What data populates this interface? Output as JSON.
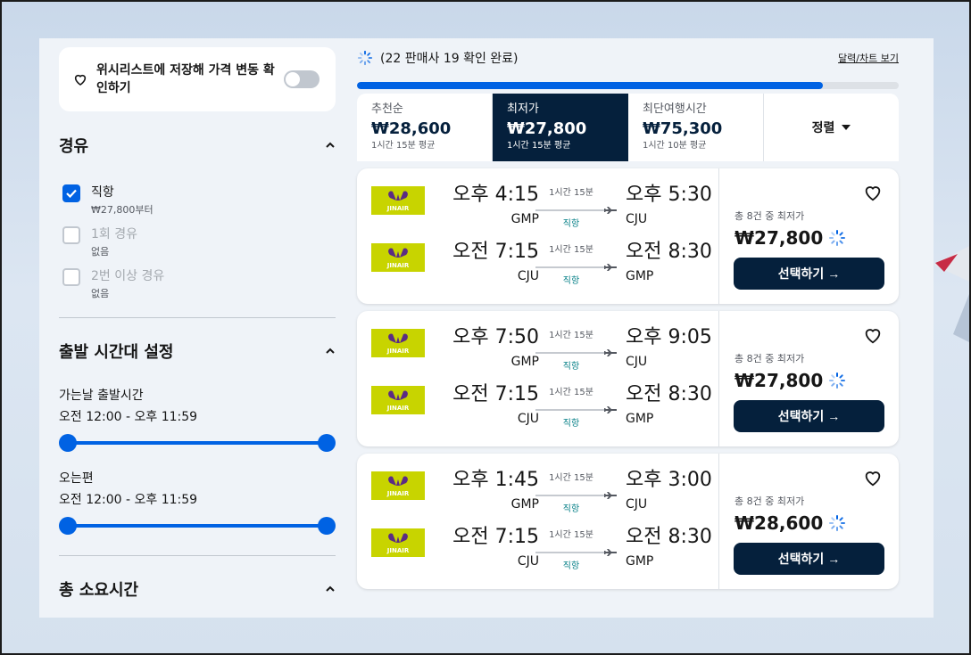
{
  "sidebar": {
    "wishlist_label": "위시리스트에 저장해 가격 변동 확인하기",
    "stops": {
      "title": "경유",
      "options": [
        {
          "label": "직항",
          "sub": "₩27,800부터",
          "checked": true
        },
        {
          "label": "1회 경유",
          "sub": "없음",
          "checked": false
        },
        {
          "label": "2번 이상 경유",
          "sub": "없음",
          "checked": false
        }
      ]
    },
    "departure_times": {
      "title": "출발 시간대 설정",
      "outbound_label": "가는날 출발시간",
      "outbound_range": "오전 12:00 - 오후 11:59",
      "return_label": "오는편",
      "return_range": "오전 12:00 - 오후 11:59"
    },
    "duration": {
      "title": "총 소요시간"
    }
  },
  "main": {
    "progress_text": "(22 판매사 19 확인 완료)",
    "progress_fraction": 0.86,
    "view_link": "달력/차트 보기",
    "sort_tabs": [
      {
        "label": "추천순",
        "price": "₩28,600",
        "sub": "1시간 15분 평균",
        "active": false
      },
      {
        "label": "최저가",
        "price": "₩27,800",
        "sub": "1시간 15분 평균",
        "active": true
      },
      {
        "label": "최단여행시간",
        "price": "₩75,300",
        "sub": "1시간 10분 평균",
        "active": false
      }
    ],
    "sort_label": "정렬",
    "results": [
      {
        "outbound": {
          "dep_time": "오후 4:15",
          "dep_code": "GMP",
          "duration": "1시간 15분",
          "stops": "직항",
          "arr_time": "오후 5:30",
          "arr_code": "CJU"
        },
        "return": {
          "dep_time": "오전 7:15",
          "dep_code": "CJU",
          "duration": "1시간 15분",
          "stops": "직항",
          "arr_time": "오전 8:30",
          "arr_code": "GMP"
        },
        "price_sub": "총 8건 중 최저가",
        "price": "₩27,800",
        "select_label": "선택하기 →"
      },
      {
        "outbound": {
          "dep_time": "오후 7:50",
          "dep_code": "GMP",
          "duration": "1시간 15분",
          "stops": "직항",
          "arr_time": "오후 9:05",
          "arr_code": "CJU"
        },
        "return": {
          "dep_time": "오전 7:15",
          "dep_code": "CJU",
          "duration": "1시간 15분",
          "stops": "직항",
          "arr_time": "오전 8:30",
          "arr_code": "GMP"
        },
        "price_sub": "총 8건 중 최저가",
        "price": "₩27,800",
        "select_label": "선택하기 →"
      },
      {
        "outbound": {
          "dep_time": "오후 1:45",
          "dep_code": "GMP",
          "duration": "1시간 15분",
          "stops": "직항",
          "arr_time": "오후 3:00",
          "arr_code": "CJU"
        },
        "return": {
          "dep_time": "오전 7:15",
          "dep_code": "CJU",
          "duration": "1시간 15분",
          "stops": "직항",
          "arr_time": "오전 8:30",
          "arr_code": "GMP"
        },
        "price_sub": "총 8건 중 최저가",
        "price": "₩28,600",
        "select_label": "선택하기 →"
      }
    ]
  },
  "colors": {
    "accent_blue": "#0062e3",
    "navy": "#05203c",
    "direct_teal": "#0c838a",
    "airline_logo_bg": "#c8d400"
  },
  "icons": [
    "heart-icon",
    "chevron-up-icon",
    "checkmark-icon",
    "spinner-icon",
    "plane-icon",
    "caret-down-icon",
    "jinair-logo"
  ]
}
